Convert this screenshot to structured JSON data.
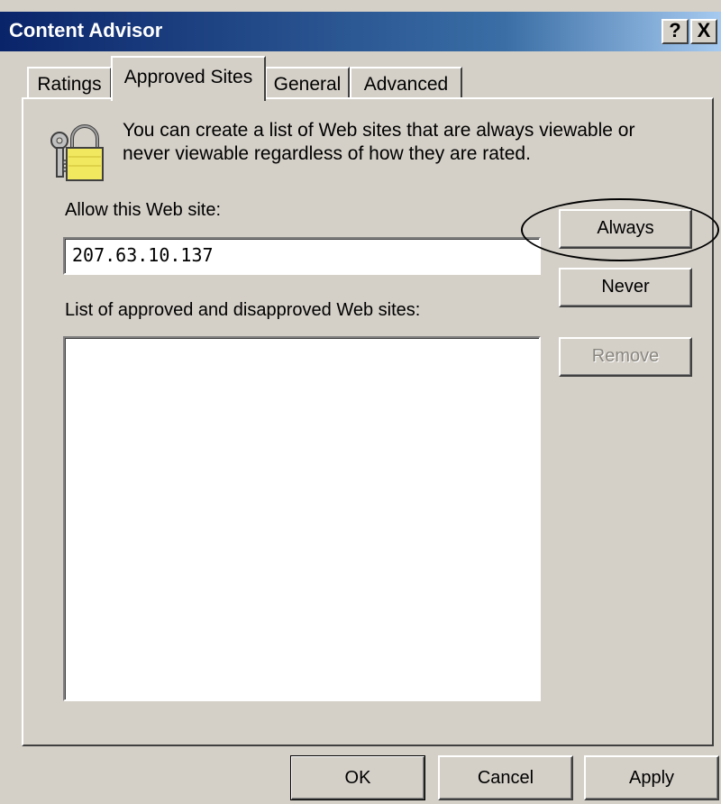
{
  "window": {
    "title": "Content Advisor",
    "help_label": "?",
    "close_label": "X"
  },
  "tabs": [
    {
      "label": "Ratings",
      "selected": false
    },
    {
      "label": "Approved Sites",
      "selected": true
    },
    {
      "label": "General",
      "selected": false
    },
    {
      "label": "Advanced",
      "selected": false
    }
  ],
  "approved_sites": {
    "icon": "lock-with-keys-icon",
    "description": "You can create a list of Web sites that are always viewable or never viewable regardless of how they are rated.",
    "allow_label": "Allow this Web site:",
    "site_value": "207.63.10.137",
    "list_label": "List of approved and disapproved Web sites:",
    "list_items": [],
    "always_label": "Always",
    "never_label": "Never",
    "remove_label": "Remove",
    "remove_enabled": false
  },
  "footer": {
    "ok_label": "OK",
    "cancel_label": "Cancel",
    "apply_label": "Apply"
  }
}
